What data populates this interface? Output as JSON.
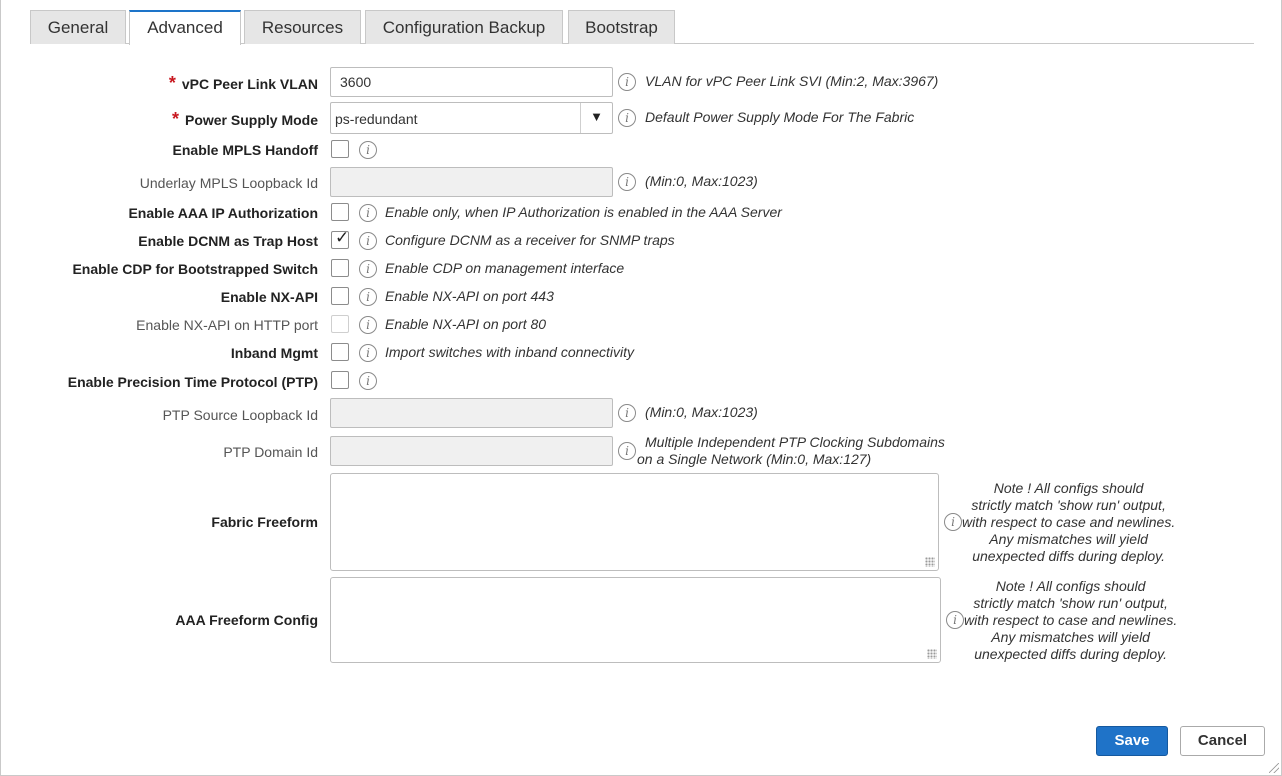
{
  "tabs": [
    {
      "label": "General"
    },
    {
      "label": "Advanced"
    },
    {
      "label": "Resources"
    },
    {
      "label": "Configuration Backup"
    },
    {
      "label": "Bootstrap"
    }
  ],
  "active_tab": "Advanced",
  "required_marker": "*",
  "fields": {
    "vpc_peer_link_vlan": {
      "label": "vPC Peer Link VLAN",
      "value": "3600",
      "help": "VLAN for vPC Peer Link SVI (Min:2, Max:3967)"
    },
    "power_supply_mode": {
      "label": "Power Supply Mode",
      "value": "ps-redundant",
      "caret": "▼",
      "help": "Default Power Supply Mode For The Fabric"
    },
    "enable_mpls_handoff": {
      "label": "Enable MPLS Handoff",
      "checked": false
    },
    "underlay_mpls_loopback_id": {
      "label": "Underlay MPLS Loopback Id",
      "value": "",
      "help": "(Min:0, Max:1023)"
    },
    "enable_aaa_ip_authorization": {
      "label": "Enable AAA IP Authorization",
      "checked": false,
      "help": "Enable only, when IP Authorization is enabled in the AAA Server"
    },
    "enable_dcnm_trap_host": {
      "label": "Enable DCNM as Trap Host",
      "checked": true,
      "help": "Configure DCNM as a receiver for SNMP traps"
    },
    "enable_cdp_bootstrapped": {
      "label": "Enable CDP for Bootstrapped Switch",
      "checked": false,
      "help": "Enable CDP on management interface"
    },
    "enable_nxapi": {
      "label": "Enable NX-API",
      "checked": false,
      "help": "Enable NX-API on port 443"
    },
    "enable_nxapi_http": {
      "label": "Enable NX-API on HTTP port",
      "checked": false,
      "help": "Enable NX-API on port 80"
    },
    "inband_mgmt": {
      "label": "Inband Mgmt",
      "checked": false,
      "help": "Import switches with inband connectivity"
    },
    "enable_ptp": {
      "label": "Enable Precision Time Protocol (PTP)",
      "checked": false
    },
    "ptp_source_loopback_id": {
      "label": "PTP Source Loopback Id",
      "value": "",
      "help": "(Min:0, Max:1023)"
    },
    "ptp_domain_id": {
      "label": "PTP Domain Id",
      "value": "",
      "help": "Multiple Independent PTP Clocking Subdomains\non a Single Network (Min:0, Max:127)"
    },
    "fabric_freeform": {
      "label": "Fabric Freeform",
      "value": "",
      "help": "Note ! All configs should\nstrictly match 'show run' output,\nwith respect to case and newlines.\nAny mismatches will yield\nunexpected diffs during deploy."
    },
    "aaa_freeform_config": {
      "label": "AAA Freeform Config",
      "value": "",
      "help": "Note ! All configs should\nstrictly match 'show run' output,\nwith respect to case and newlines.\nAny mismatches will yield\nunexpected diffs during deploy."
    }
  },
  "check_glyph": "✓",
  "info_glyph": "i",
  "buttons": {
    "save": "Save",
    "cancel": "Cancel"
  },
  "colors": {
    "accent": "#1f73c8",
    "required": "#c8171f"
  }
}
